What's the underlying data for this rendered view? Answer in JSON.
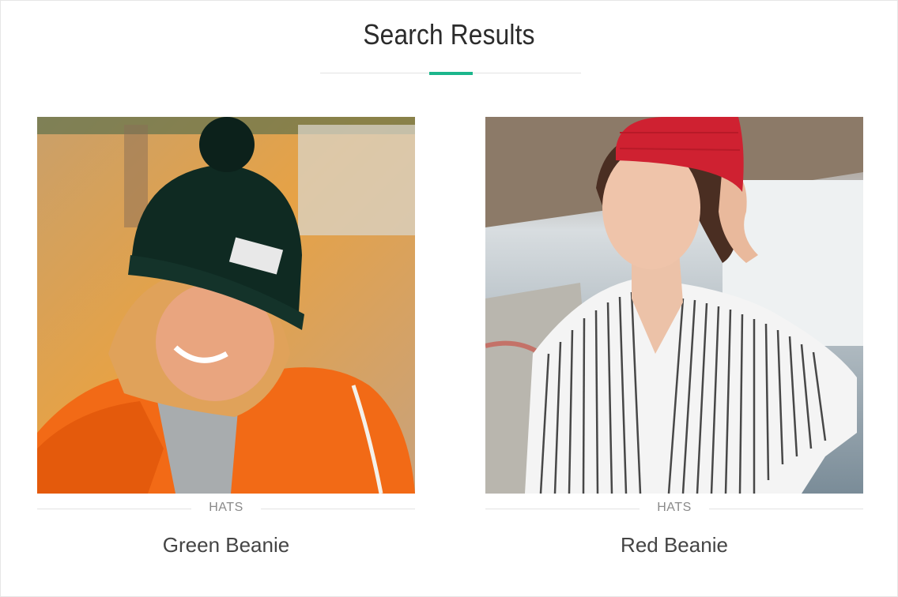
{
  "page": {
    "title": "Search Results",
    "accent_color": "#1cb68c"
  },
  "results": [
    {
      "category": "HATS",
      "name": "Green Beanie",
      "image": "woman-in-green-beanie-and-orange-jacket-photo"
    },
    {
      "category": "HATS",
      "name": "Red Beanie",
      "image": "woman-in-red-beanie-and-striped-shirt-photo"
    }
  ]
}
